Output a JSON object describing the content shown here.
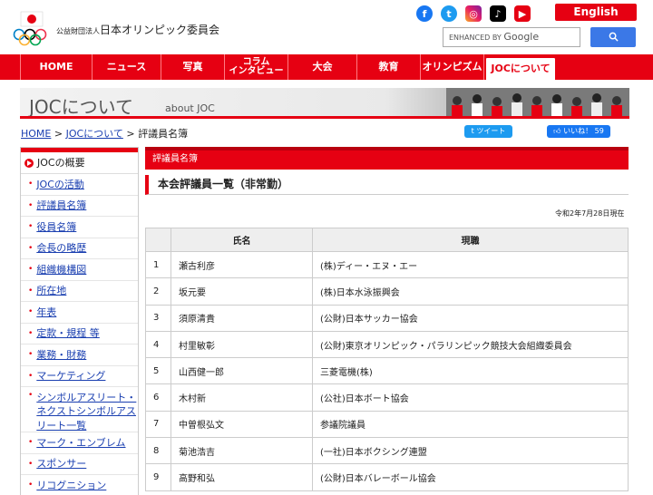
{
  "header": {
    "org_prefix": "公益財団法人",
    "org_name": "日本オリンピック委員会",
    "english_label": "English",
    "search_prefix": "ENHANCED BY",
    "search_brand": "Google",
    "search_button_icon": "search-icon",
    "social_icons": [
      "facebook-icon",
      "twitter-icon",
      "instagram-icon",
      "tiktok-icon",
      "youtube-icon"
    ],
    "colors": {
      "brand_red": "#e60012",
      "link_blue": "#1a3fb0"
    }
  },
  "nav": {
    "items": [
      {
        "label": "HOME"
      },
      {
        "label": "ニュース"
      },
      {
        "label": "写真"
      },
      {
        "label": "コラム\nインタビュー"
      },
      {
        "label": "大会"
      },
      {
        "label": "教育"
      },
      {
        "label": "オリンピズム"
      },
      {
        "label": "JOCについて"
      }
    ],
    "active_index": 7
  },
  "banner": {
    "title": "JOCについて",
    "subtitle": "about JOC"
  },
  "breadcrumb": {
    "home": "HOME",
    "sep": ">",
    "parent": "JOCについて",
    "current": "評議員名簿"
  },
  "share": {
    "tweet": "ツイート",
    "like": "いいね！ 59"
  },
  "sidebar": {
    "heading": "JOCの概要",
    "items": [
      {
        "label": "JOCの活動"
      },
      {
        "label": "評議員名簿"
      },
      {
        "label": "役員名簿"
      },
      {
        "label": "会長の略歴"
      },
      {
        "label": "組織機構図"
      },
      {
        "label": "所在地"
      },
      {
        "label": "年表"
      },
      {
        "label": "定款・規程 等"
      },
      {
        "label": "業務・財務"
      },
      {
        "label": "マーケティング"
      },
      {
        "label": "シンボルアスリート・ネクストシンボルアスリート一覧"
      },
      {
        "label": "マーク・エンブレム"
      },
      {
        "label": "スポンサー"
      },
      {
        "label": "リコグニション"
      }
    ]
  },
  "main": {
    "section_title": "評議員名簿",
    "heading": "本会評議員一覧（非常勤）",
    "date": "令和2年7月28日現在",
    "table": {
      "headers": [
        "",
        "氏名",
        "現職"
      ],
      "rows": [
        [
          "1",
          "瀬古利彦",
          "(株)ディー・エヌ・エー"
        ],
        [
          "2",
          "坂元要",
          "(株)日本水泳振興会"
        ],
        [
          "3",
          "須原清貴",
          "(公財)日本サッカー協会"
        ],
        [
          "4",
          "村里敏彰",
          "(公財)東京オリンピック・パラリンピック競技大会組織委員会"
        ],
        [
          "5",
          "山西健一郎",
          "三菱電機(株)"
        ],
        [
          "6",
          "木村新",
          "(公社)日本ボート協会"
        ],
        [
          "7",
          "中曽根弘文",
          "参議院議員"
        ],
        [
          "8",
          "菊池浩吉",
          "(一社)日本ボクシング連盟"
        ],
        [
          "9",
          "高野和弘",
          "(公財)日本バレーボール協会"
        ]
      ]
    }
  }
}
